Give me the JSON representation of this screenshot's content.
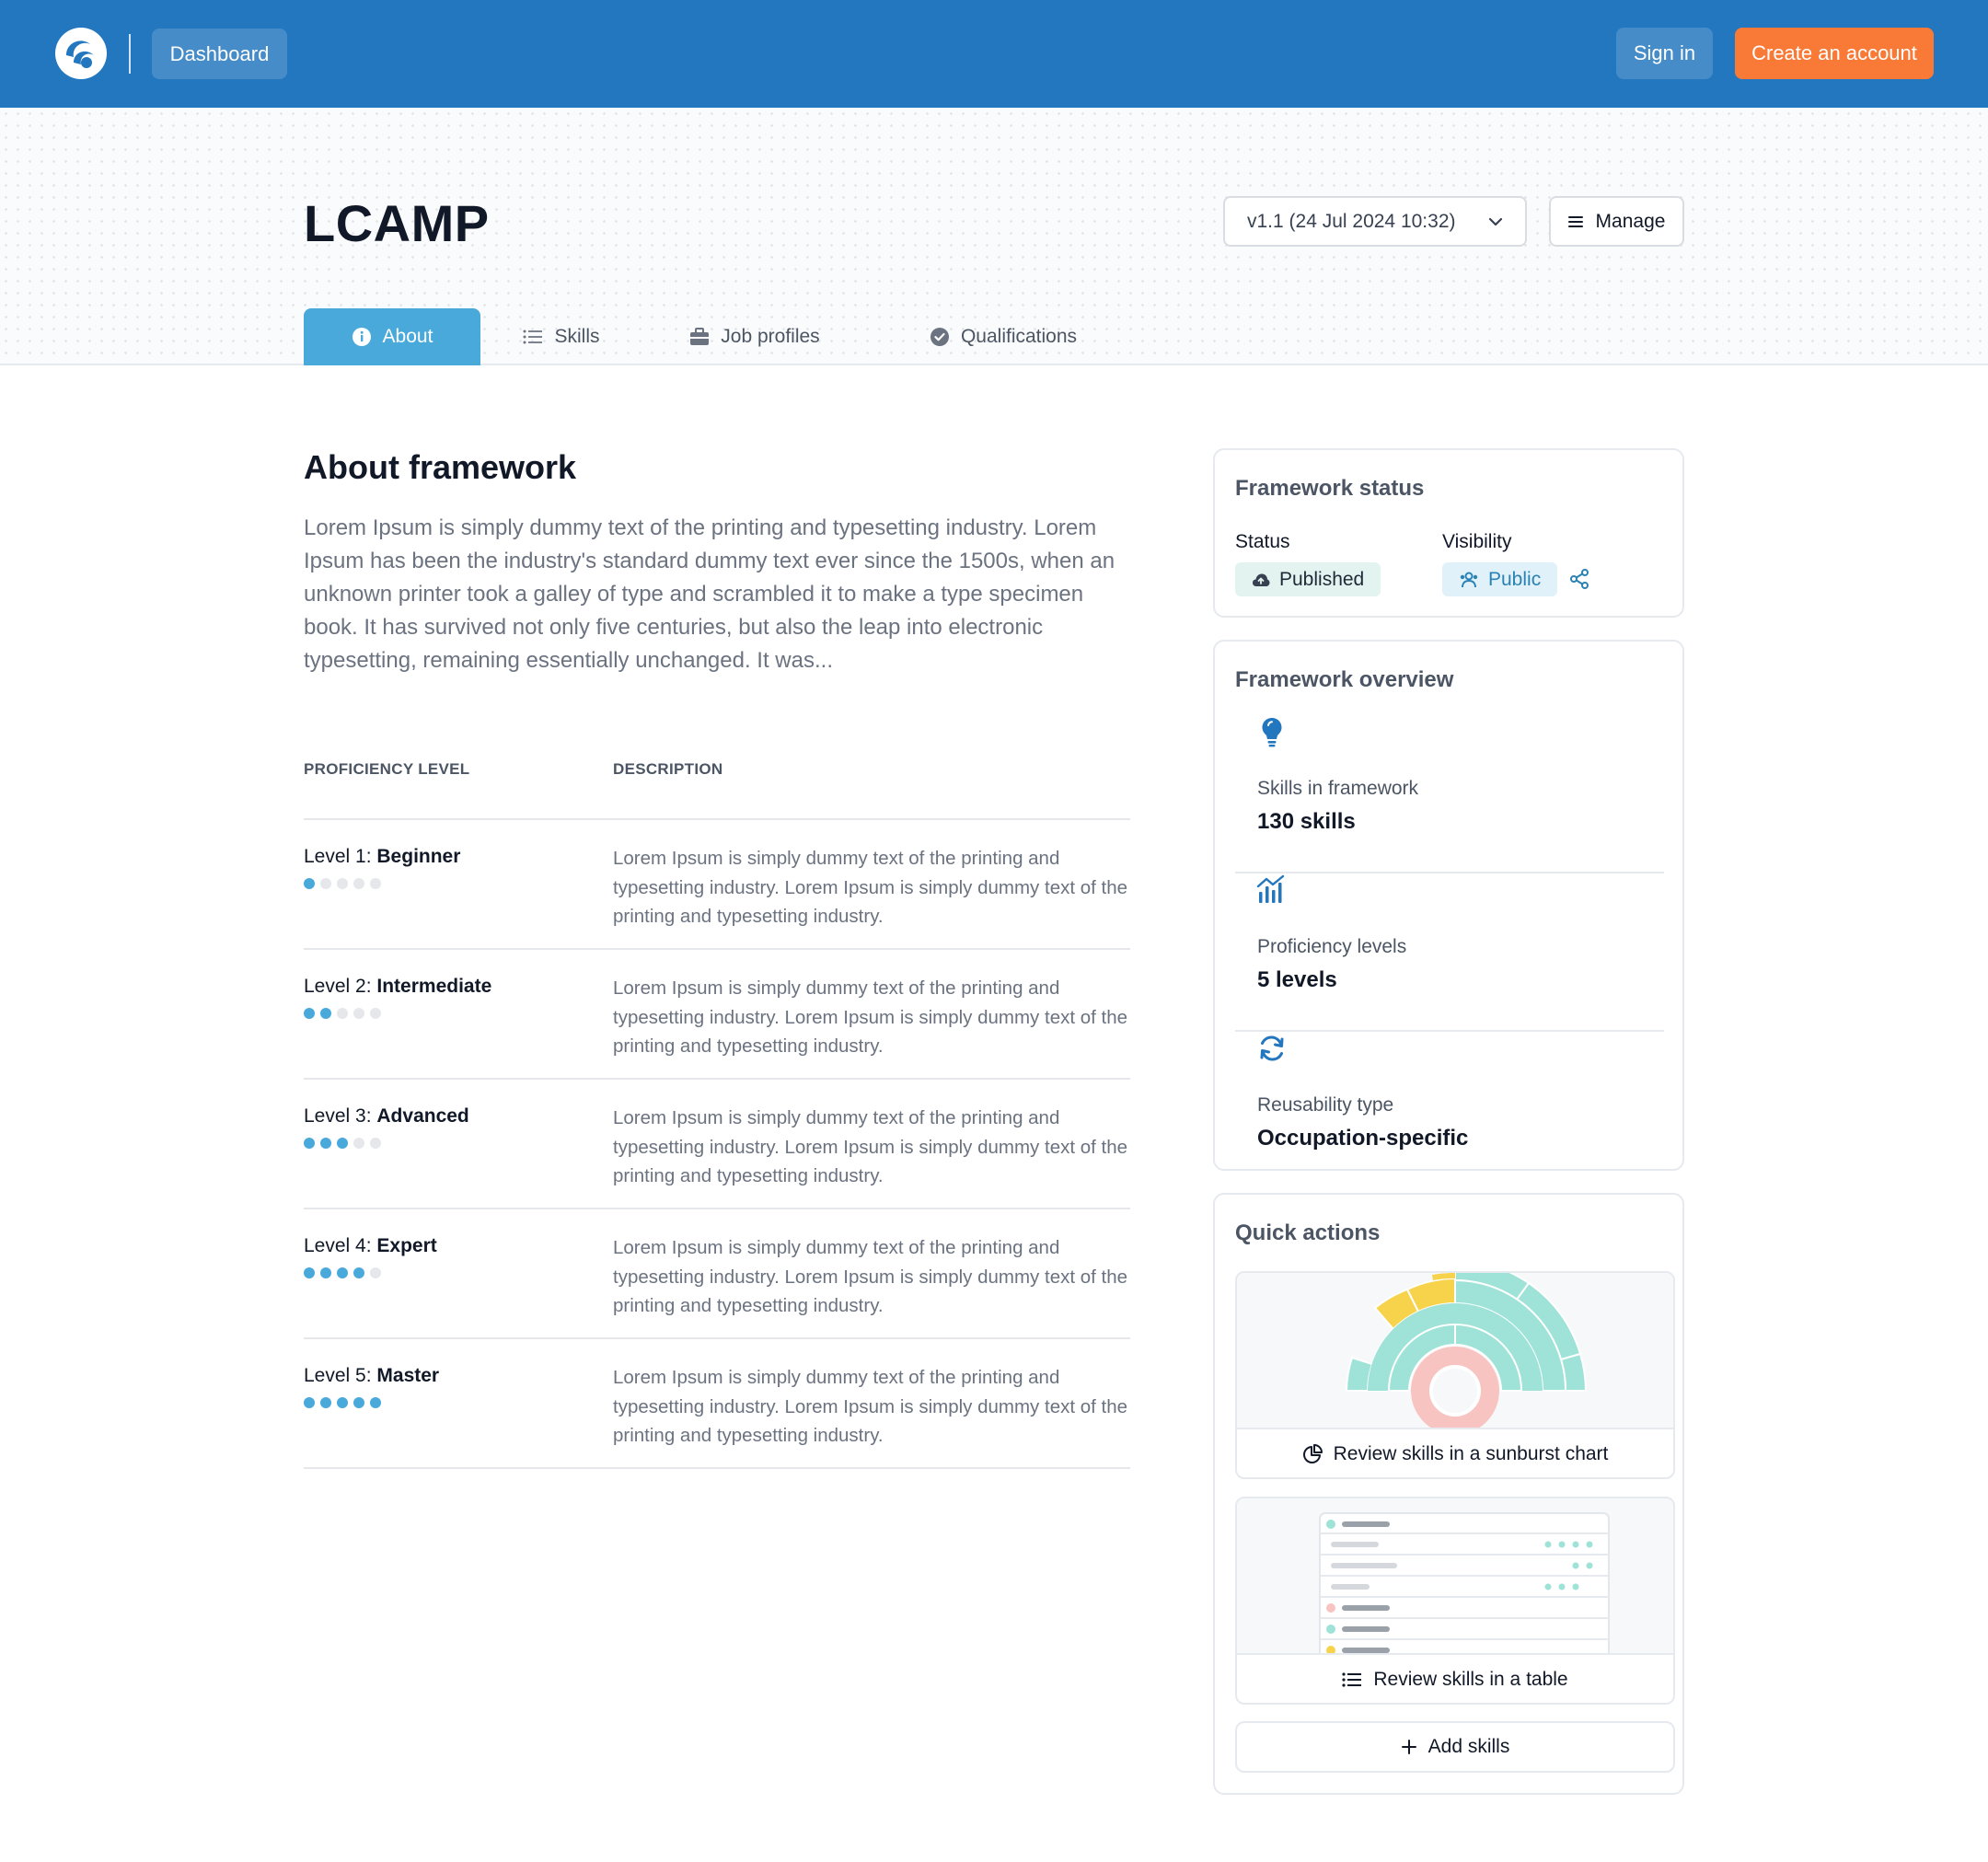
{
  "header": {
    "dashboard_label": "Dashboard",
    "signin_label": "Sign in",
    "create_label": "Create an account"
  },
  "framework": {
    "title": "LCAMP",
    "version": "v1.1 (24 Jul 2024 10:32)",
    "manage_label": "Manage"
  },
  "tabs": [
    {
      "label": "About",
      "icon": "info-icon",
      "active": true
    },
    {
      "label": "Skills",
      "icon": "list-icon",
      "active": false
    },
    {
      "label": "Job profiles",
      "icon": "briefcase-icon",
      "active": false
    },
    {
      "label": "Qualifications",
      "icon": "badge-check-icon",
      "active": false
    }
  ],
  "about": {
    "title": "About framework",
    "text": "Lorem Ipsum is simply dummy text of the printing and typesetting industry. Lorem Ipsum has been the industry's standard dummy text ever since the 1500s, when an unknown printer took a galley of type and scrambled it to make a type specimen book. It has survived not only five centuries, but also the leap into electronic typesetting, remaining essentially unchanged. It was..."
  },
  "proficiency": {
    "headers": {
      "level": "PROFICIENCY LEVEL",
      "description": "DESCRIPTION"
    },
    "rows": [
      {
        "prefix": "Level 1: ",
        "name": "Beginner",
        "filled": 1,
        "total": 5,
        "description": "Lorem Ipsum is simply dummy text of the printing and typesetting industry. Lorem Ipsum is simply dummy text of the printing and typesetting industry."
      },
      {
        "prefix": "Level 2: ",
        "name": "Intermediate",
        "filled": 2,
        "total": 5,
        "description": "Lorem Ipsum is simply dummy text of the printing and typesetting industry. Lorem Ipsum is simply dummy text of the printing and typesetting industry."
      },
      {
        "prefix": "Level 3: ",
        "name": "Advanced",
        "filled": 3,
        "total": 5,
        "description": "Lorem Ipsum is simply dummy text of the printing and typesetting industry. Lorem Ipsum is simply dummy text of the printing and typesetting industry."
      },
      {
        "prefix": "Level 4: ",
        "name": "Expert",
        "filled": 4,
        "total": 5,
        "description": "Lorem Ipsum is simply dummy text of the printing and typesetting industry. Lorem Ipsum is simply dummy text of the printing and typesetting industry."
      },
      {
        "prefix": "Level 5: ",
        "name": "Master",
        "filled": 5,
        "total": 5,
        "description": "Lorem Ipsum is simply dummy text of the printing and typesetting industry. Lorem Ipsum is simply dummy text of the printing and typesetting industry."
      }
    ]
  },
  "status_card": {
    "title": "Framework status",
    "status_label": "Status",
    "status_value": "Published",
    "visibility_label": "Visibility",
    "visibility_value": "Public"
  },
  "overview": {
    "title": "Framework overview",
    "items": [
      {
        "label": "Skills in framework",
        "value": "130 skills",
        "icon": "lightbulb-icon"
      },
      {
        "label": "Proficiency levels",
        "value": "5 levels",
        "icon": "chart-levels-icon"
      },
      {
        "label": "Reusability type",
        "value": "Occupation-specific",
        "icon": "refresh-icon"
      }
    ]
  },
  "quick_actions": {
    "title": "Quick actions",
    "sunburst_label": "Review skills in a sunburst chart",
    "table_label": "Review skills in a table",
    "add_label": "Add skills"
  },
  "colors": {
    "topbar": "#2277bf",
    "accent": "#4aa9db",
    "cta": "#f97a37",
    "teal": "#9fe3d8",
    "yellow": "#f7d34c",
    "pink": "#f8c4c1"
  }
}
